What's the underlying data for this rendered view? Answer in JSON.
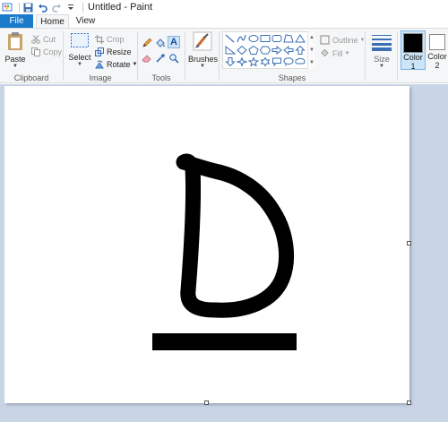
{
  "app": {
    "title": "Untitled - Paint"
  },
  "tabs": {
    "file": "File",
    "home": "Home",
    "view": "View"
  },
  "clipboard": {
    "paste": "Paste",
    "cut": "Cut",
    "copy": "Copy",
    "label": "Clipboard"
  },
  "image": {
    "select": "Select",
    "crop": "Crop",
    "resize": "Resize",
    "rotate": "Rotate",
    "label": "Image"
  },
  "tools": {
    "label": "Tools"
  },
  "brushes": {
    "label": "Brushes"
  },
  "shapes": {
    "outline": "Outline",
    "fill": "Fill",
    "label": "Shapes"
  },
  "size": {
    "label": "Size"
  },
  "colors": {
    "color1_label": "Color",
    "color1_num": "1",
    "color1_value": "#000000",
    "color2_label": "Color",
    "color2_num": "2",
    "color2_value": "#ffffff",
    "accent": "#1979ca"
  }
}
